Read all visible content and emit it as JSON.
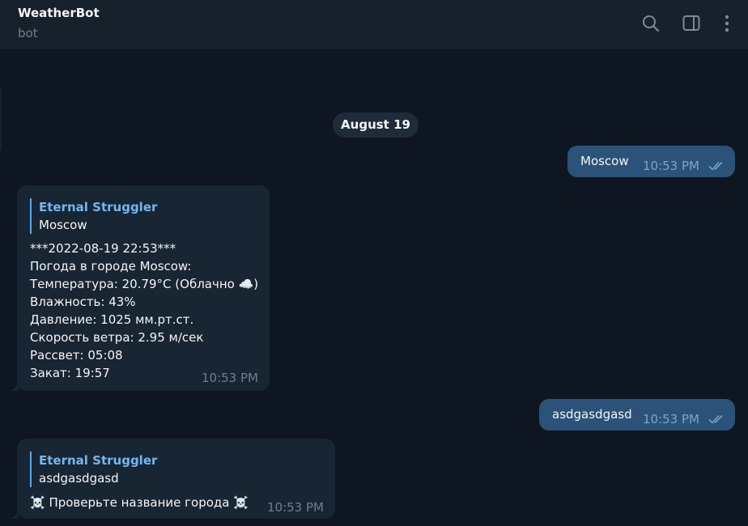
{
  "header": {
    "title": "WeatherBot",
    "subtitle": "bot",
    "icons": [
      "search-icon",
      "sidebar-toggle-icon",
      "more-icon"
    ]
  },
  "date_separator": "August 19",
  "messages": [
    {
      "direction": "out",
      "text": "Moscow",
      "time": "10:53 PM",
      "status": "read"
    },
    {
      "direction": "in",
      "reply_author": "Eternal Struggler",
      "reply_text": "Moscow",
      "lines": [
        "***2022-08-19 22:53***",
        "Погода в городе Moscow:",
        "Температура: 20.79°C (Облачно ☁️)",
        "Влажность: 43%",
        "Давление: 1025 мм.рт.ст.",
        "Скорость ветра: 2.95 м/сек",
        "Рассвет: 05:08",
        "Закат: 19:57"
      ],
      "time": "10:53 PM"
    },
    {
      "direction": "out",
      "text": "asdgasdgasd",
      "time": "10:53 PM",
      "status": "read"
    },
    {
      "direction": "in",
      "reply_author": "Eternal Struggler",
      "reply_text": "asdgasdgasd",
      "lines": [
        "☠️ Проверьте название города ☠️"
      ],
      "time": "10:53 PM"
    }
  ],
  "colors": {
    "background": "#0e1621",
    "header": "#17212b",
    "outgoing_bubble": "#2b5278",
    "incoming_bubble": "#182533",
    "accent": "#71b7f2"
  }
}
